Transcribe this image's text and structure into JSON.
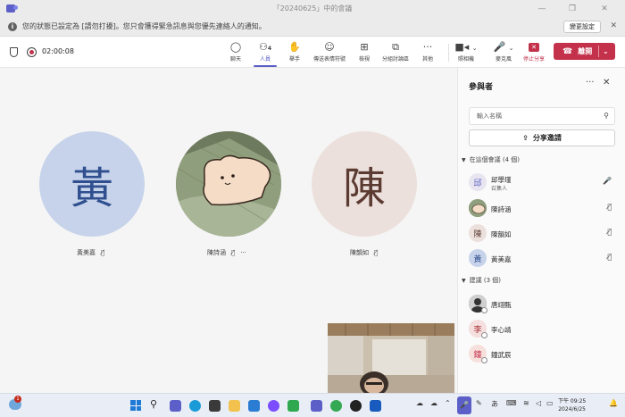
{
  "window": {
    "title": "「20240625」中的會議",
    "controls": [
      "minimize-icon",
      "restore-icon",
      "close-icon"
    ]
  },
  "banner": {
    "message": "您的狀態已設定為 [請勿打擾]。您只會獲得緊急訊息與您優先連絡人的通知。",
    "action_label": "變更設定",
    "close": "✕"
  },
  "toolbar": {
    "timer": "02:00:08",
    "buttons": [
      {
        "icon": "chat-icon",
        "label": "聊天"
      },
      {
        "icon": "people-icon",
        "label": "人員",
        "count": "4",
        "active": true
      },
      {
        "icon": "raise-hand-icon",
        "label": "舉手"
      },
      {
        "icon": "emoji-icon",
        "label": "傳送表情符號"
      },
      {
        "icon": "view-icon",
        "label": "檢視"
      },
      {
        "icon": "breakout-rooms-icon",
        "label": "分組討論區"
      },
      {
        "icon": "more-icon",
        "label": "其他"
      },
      {
        "icon": "camera-icon",
        "label": "照相機"
      },
      {
        "icon": "mic-icon",
        "label": "麥克風"
      },
      {
        "icon": "stop-share-icon",
        "label": "停止分享"
      }
    ],
    "leave_label": "離開"
  },
  "stage": {
    "participants": [
      {
        "name": "黃美嘉",
        "initial": "黃",
        "bg": "#c7d3ea",
        "fg": "#2f4f8f",
        "muted": true
      },
      {
        "name": "陳詩涵",
        "initial": "",
        "photo": true,
        "muted": true,
        "more": "···"
      },
      {
        "name": "陳韻如",
        "initial": "陳",
        "bg": "#ece0dc",
        "fg": "#5b3b32",
        "muted": true
      }
    ]
  },
  "panel": {
    "title": "參與者",
    "search_placeholder": "輸入名稱",
    "share_label": "分享邀請",
    "in_meeting_label": "在這個會議 (4 個)",
    "in_meeting": [
      {
        "name": "邱學瑾",
        "role": "召集人",
        "initial": "邱",
        "bg": "#e8e5f0",
        "fg": "#5b5fc7",
        "mic": "on"
      },
      {
        "name": "陳詩涵",
        "initial": "",
        "photo": true,
        "mic": "off"
      },
      {
        "name": "陳韻如",
        "initial": "陳",
        "bg": "#ece0dc",
        "fg": "#5b3b32",
        "mic": "off"
      },
      {
        "name": "黃美嘉",
        "initial": "黃",
        "bg": "#c7d3ea",
        "fg": "#2f4f8f",
        "mic": "off"
      }
    ],
    "suggested_label": "建議 (3 個)",
    "suggested": [
      {
        "name": "唐翊甄",
        "initial": "",
        "photo": true
      },
      {
        "name": "李心靖",
        "initial": "李",
        "bg": "#f4dede",
        "fg": "#a4262c"
      },
      {
        "name": "鐘武辰",
        "initial": "鐘",
        "bg": "#f7e0dc",
        "fg": "#c4314b"
      }
    ]
  },
  "taskbar": {
    "notification_count": "1",
    "ime_label": "あ",
    "time": "下午 09:25",
    "date": "2024/6/25"
  },
  "colors": {
    "accent": "#5b5fc7",
    "leave": "#c4314b"
  }
}
